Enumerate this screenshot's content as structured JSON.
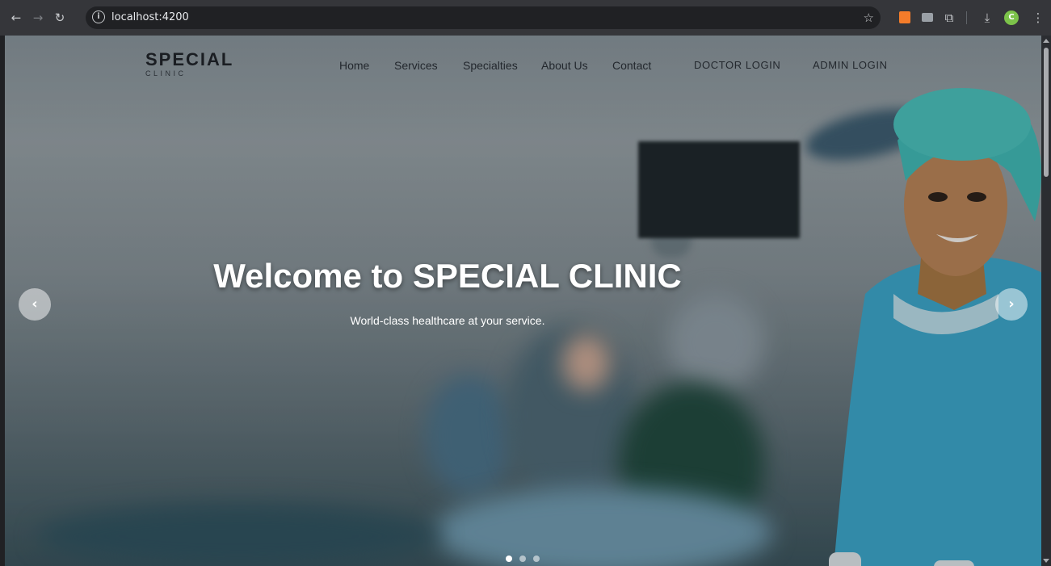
{
  "browser": {
    "url": "localhost:4200",
    "back_icon": "←",
    "forward_icon": "→",
    "reload_icon": "↻",
    "star_icon": "☆",
    "download_icon": "⤓",
    "menu_icon": "⋮",
    "profile_initial": "C"
  },
  "site": {
    "brand": "SPECIAL",
    "brand_sub": "CLINIC",
    "nav": [
      "Home",
      "Services",
      "Specialties",
      "About Us",
      "Contact"
    ],
    "doctor_login": "DOCTOR LOGIN",
    "admin_login": "ADMIN LOGIN"
  },
  "carousel": {
    "title": "Welcome to SPECIAL CLINIC",
    "subtitle": "World-class healthcare at your service.",
    "prev_icon": "‹",
    "next_icon": "›",
    "slide_count": 3,
    "active_slide": 1
  },
  "colors": {
    "scrub_blue": "#3aa3c6",
    "cap_teal": "#3fb6b1"
  }
}
